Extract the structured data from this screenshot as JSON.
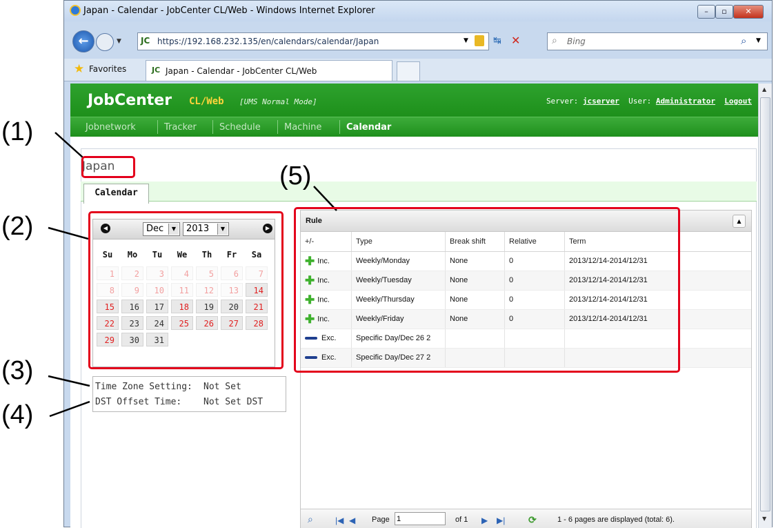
{
  "browser": {
    "title": "Japan - Calendar - JobCenter CL/Web - Windows Internet Explorer",
    "url": "https://192.168.232.135/en/calendars/calendar/Japan",
    "search_placeholder": "Bing",
    "favorites_label": "Favorites",
    "tab_title": "Japan - Calendar - JobCenter CL/Web",
    "tab_icon_text": "JC"
  },
  "header": {
    "brand": "JobCenter",
    "brand_sub": "CL/Web",
    "mode": "[UMS Normal Mode]",
    "server_label": "Server:",
    "server_value": "jcserver",
    "user_label": "User:",
    "user_value": "Administrator",
    "logout": "Logout"
  },
  "menu": [
    {
      "label": "Jobnetwork",
      "active": false
    },
    {
      "label": "Tracker",
      "active": false
    },
    {
      "label": "Schedule",
      "active": false
    },
    {
      "label": "Machine",
      "active": false
    },
    {
      "label": "Calendar",
      "active": true
    }
  ],
  "page": {
    "title": "Japan",
    "tab": "Calendar"
  },
  "calendar": {
    "month": "Dec",
    "year": "2013",
    "weekdays": [
      "Su",
      "Mo",
      "Tu",
      "We",
      "Th",
      "Fr",
      "Sa"
    ]
  },
  "timezone": {
    "tz_label": "Time Zone Setting:",
    "tz_value": "Not Set",
    "dst_label": "DST Offset Time:",
    "dst_value": "Not Set DST"
  },
  "rules": {
    "title": "Rule",
    "columns": [
      "+/-",
      "Type",
      "Break shift",
      "Relative",
      "Term"
    ],
    "rows": [
      {
        "sign": "+",
        "mode": "Inc.",
        "type": "Weekly/Monday",
        "break_shift": "None",
        "relative": "0",
        "term": "2013/12/14-2014/12/31"
      },
      {
        "sign": "+",
        "mode": "Inc.",
        "type": "Weekly/Tuesday",
        "break_shift": "None",
        "relative": "0",
        "term": "2013/12/14-2014/12/31"
      },
      {
        "sign": "+",
        "mode": "Inc.",
        "type": "Weekly/Thursday",
        "break_shift": "None",
        "relative": "0",
        "term": "2013/12/14-2014/12/31"
      },
      {
        "sign": "+",
        "mode": "Inc.",
        "type": "Weekly/Friday",
        "break_shift": "None",
        "relative": "0",
        "term": "2013/12/14-2014/12/31"
      },
      {
        "sign": "-",
        "mode": "Exc.",
        "type": "Specific Day/Dec 26 2",
        "break_shift": "",
        "relative": "",
        "term": ""
      },
      {
        "sign": "-",
        "mode": "Exc.",
        "type": "Specific Day/Dec 27 2",
        "break_shift": "",
        "relative": "",
        "term": ""
      }
    ],
    "pager": {
      "page_label": "Page",
      "page_value": "1",
      "of_label": "of 1",
      "status": "1 - 6 pages are displayed (total: 6)."
    }
  },
  "callouts": [
    "(1)",
    "(2)",
    "(3)",
    "(4)",
    "(5)"
  ],
  "colors": {
    "accent_green": "#1f8f1c",
    "callout_red": "#e3001b",
    "brand_yellow": "#ffd43b"
  }
}
